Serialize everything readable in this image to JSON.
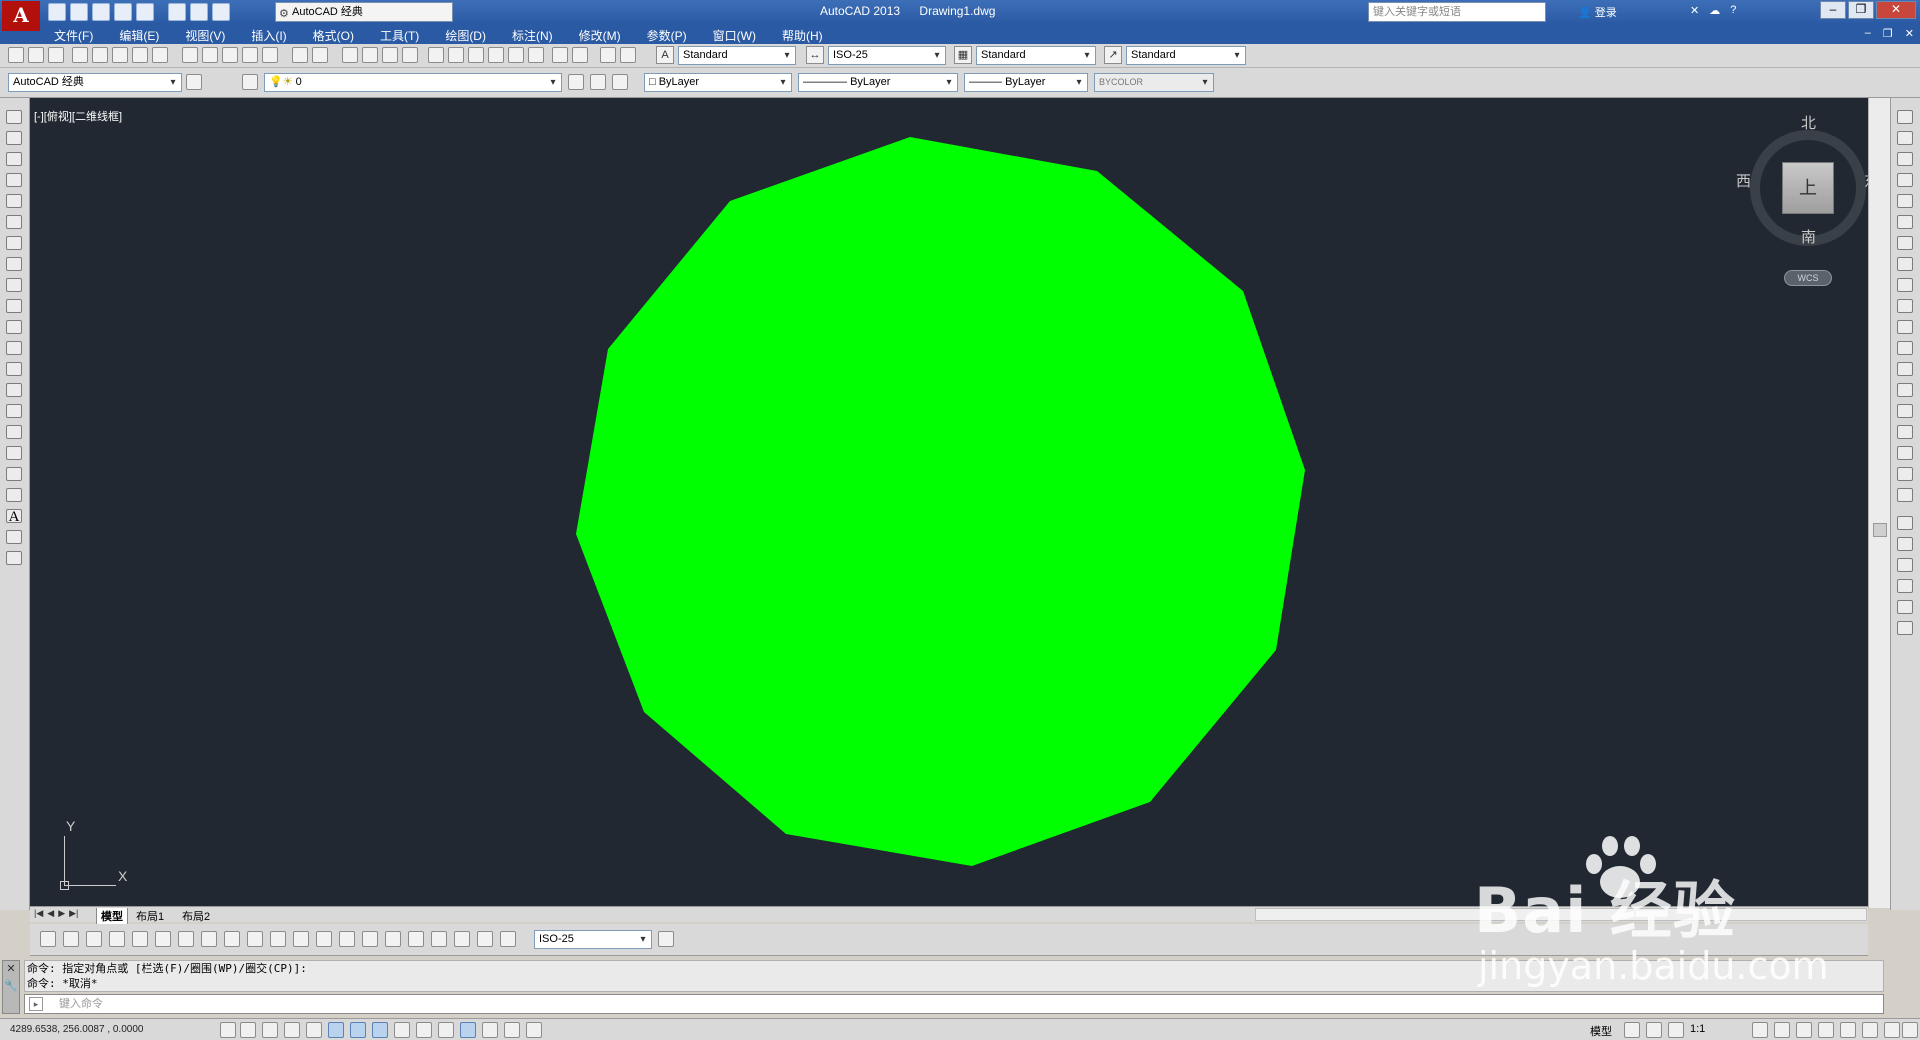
{
  "app": {
    "logo_letter": "A",
    "title": "AutoCAD 2013",
    "document": "Drawing1.dwg",
    "workspace": "AutoCAD 经典",
    "search_placeholder": "键入关键字或短语",
    "login": "登录"
  },
  "menu": [
    "文件(F)",
    "编辑(E)",
    "视图(V)",
    "插入(I)",
    "格式(O)",
    "工具(T)",
    "绘图(D)",
    "标注(N)",
    "修改(M)",
    "参数(P)",
    "窗口(W)",
    "帮助(H)"
  ],
  "styles": {
    "text_style": "Standard",
    "dim_style": "ISO-25",
    "table_style": "Standard",
    "mleader_style": "Standard"
  },
  "layers": {
    "workspace": "AutoCAD 经典",
    "current_layer": "0",
    "color": "ByLayer",
    "linetype": "ByLayer",
    "lineweight": "ByLayer",
    "plotstyle": "BYCOLOR"
  },
  "viewport": {
    "label": "[-][俯视][二维线框]",
    "fill_color": "#00ff00",
    "background": "#212831"
  },
  "viewcube": {
    "north": "北",
    "south": "南",
    "west": "西",
    "east": "东",
    "face": "上",
    "wcs": "WCS"
  },
  "ucs": {
    "x": "X",
    "y": "Y"
  },
  "tabs": [
    "模型",
    "布局1",
    "布局2"
  ],
  "dim_toolbar": {
    "dim_style": "ISO-25"
  },
  "command": {
    "history": [
      "命令: 指定对角点或 [栏选(F)/圈围(WP)/圈交(CP)]:",
      "命令: *取消*"
    ],
    "placeholder": "键入命令"
  },
  "status": {
    "coordinates": "4289.6538, 256.0087 , 0.0000",
    "model": "模型",
    "scale": "1:1"
  },
  "watermark": {
    "brand": "Bai   经验",
    "url": "jingyan.baidu.com"
  }
}
